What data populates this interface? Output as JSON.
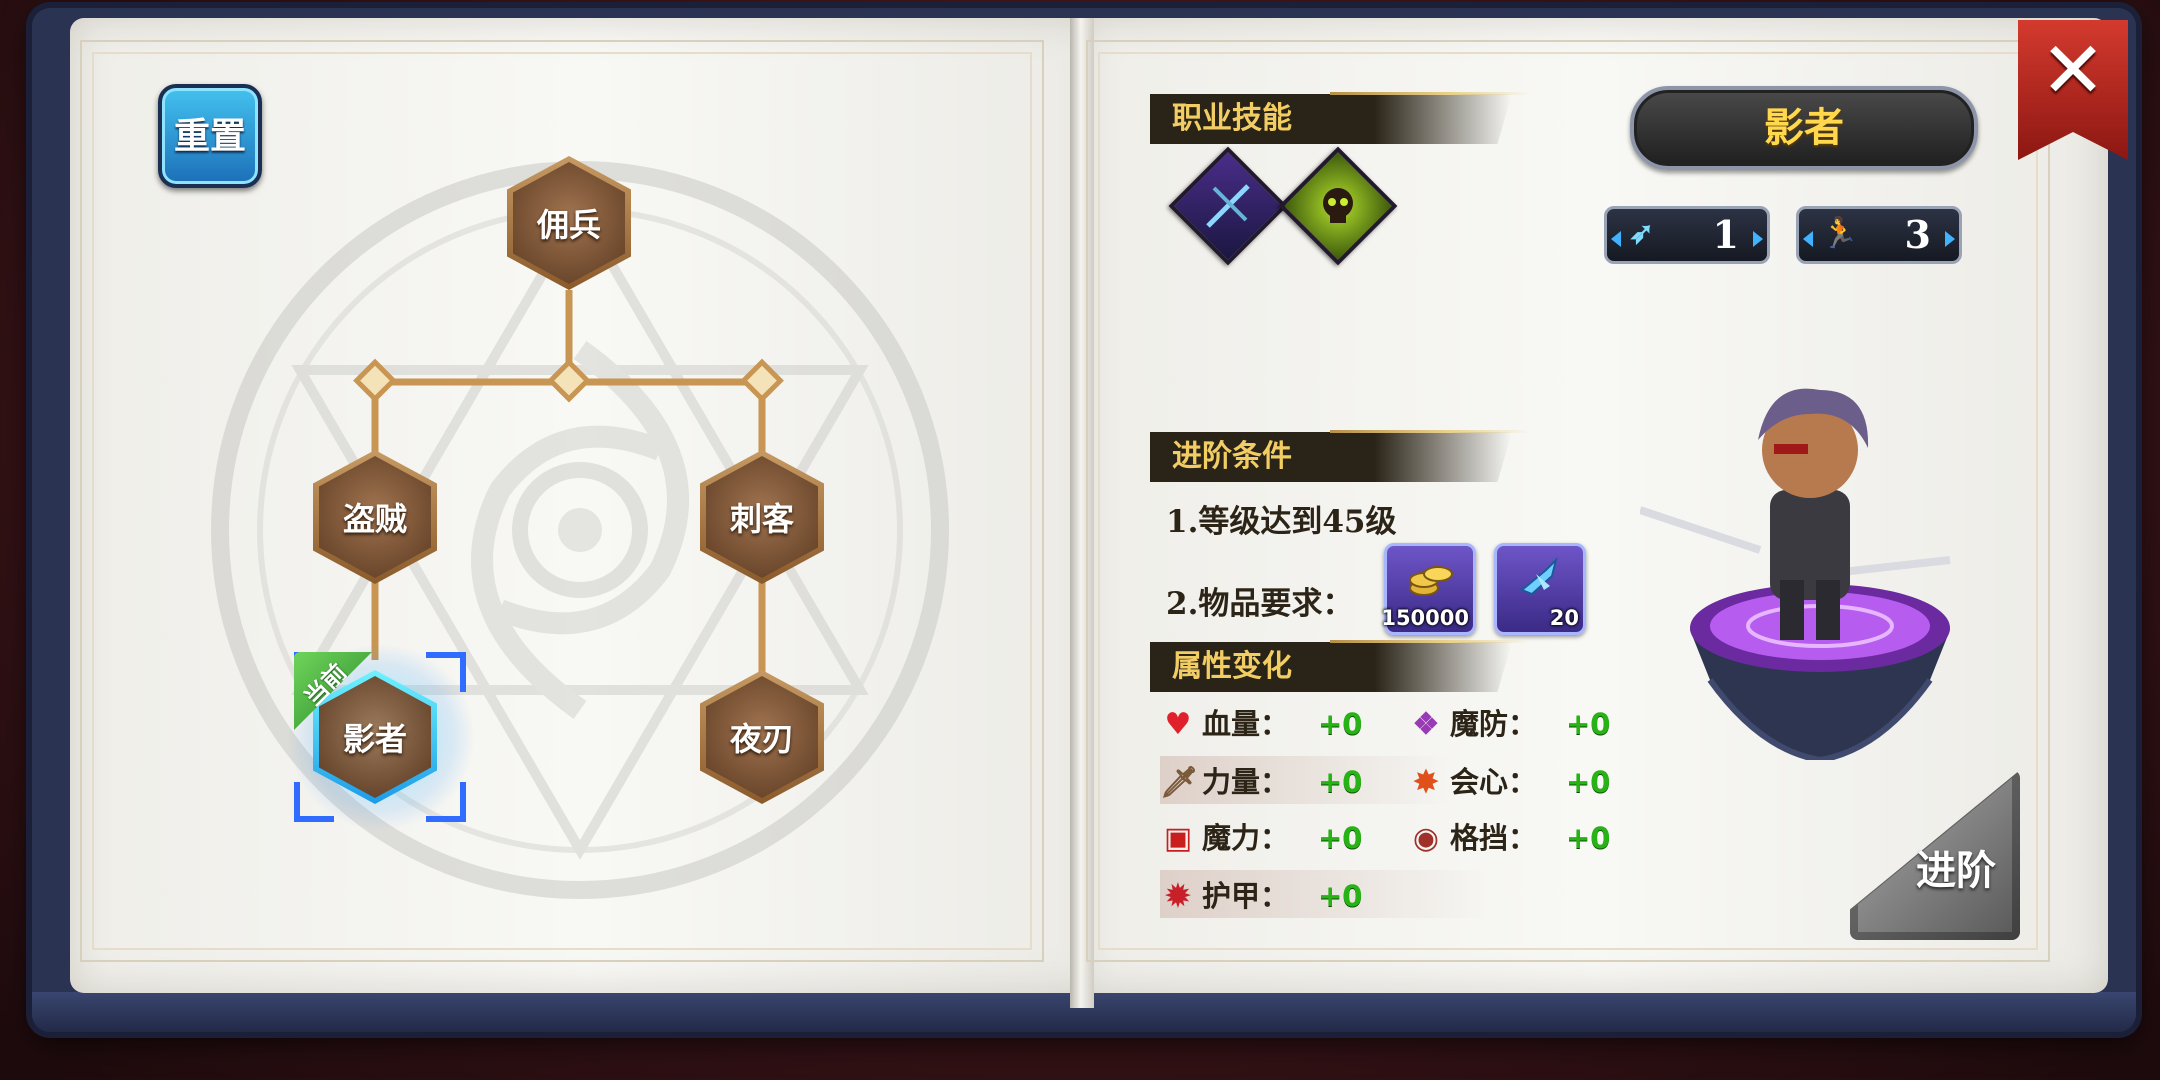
{
  "reset_label": "重置",
  "class_tree": {
    "root": "佣兵",
    "branch_left": "盗贼",
    "branch_right": "刺客",
    "leaf_left": "影者",
    "leaf_right": "夜刃",
    "current_tag": "当前"
  },
  "right_page": {
    "skills_title": "职业技能",
    "skills": [
      {
        "icon": "dual-blade-skill-icon"
      },
      {
        "icon": "poison-skull-skill-icon"
      }
    ],
    "class_name": "影者",
    "stats": [
      {
        "icon": "attack-range-icon",
        "value": "1"
      },
      {
        "icon": "speed-icon",
        "value": "3"
      }
    ],
    "advance_title": "进阶条件",
    "condition_1": "1.等级达到45级",
    "condition_2": "2.物品要求：",
    "items": [
      {
        "icon": "gold-coins-icon",
        "qty": "150000"
      },
      {
        "icon": "blue-crystal-icon",
        "qty": "20"
      }
    ],
    "attr_title": "属性变化",
    "attributes": [
      {
        "label": "血量：",
        "value": "+0",
        "icon": "heart-icon"
      },
      {
        "label": "魔防：",
        "value": "+0",
        "icon": "magic-defense-icon"
      },
      {
        "label": "力量：",
        "value": "+0",
        "icon": "sword-icon"
      },
      {
        "label": "会心：",
        "value": "+0",
        "icon": "critical-icon"
      },
      {
        "label": "魔力：",
        "value": "+0",
        "icon": "spellbook-icon"
      },
      {
        "label": "格挡：",
        "value": "+0",
        "icon": "shield-block-icon"
      },
      {
        "label": "护甲：",
        "value": "+0",
        "icon": "armor-icon"
      }
    ],
    "advance_button": "进阶"
  },
  "colors": {
    "title_gold": "#f2cd63",
    "stat_green": "#27b316",
    "current_glow": "#4fd8ff"
  }
}
